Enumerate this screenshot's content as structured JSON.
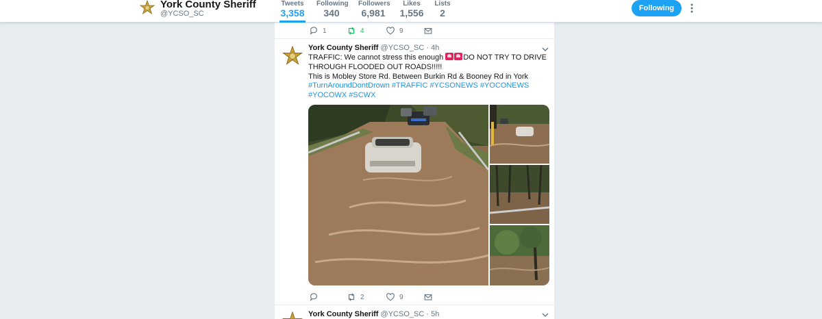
{
  "profile": {
    "name": "York County Sheriff",
    "handle": "@YCSO_SC"
  },
  "stats": [
    {
      "label": "Tweets",
      "value": "3,358",
      "active": true
    },
    {
      "label": "Following",
      "value": "340",
      "active": false
    },
    {
      "label": "Followers",
      "value": "6,981",
      "active": false
    },
    {
      "label": "Likes",
      "value": "1,556",
      "active": false
    },
    {
      "label": "Lists",
      "value": "2",
      "active": false
    }
  ],
  "follow_button": "Following",
  "prev_tweet_actions": {
    "reply": "1",
    "retweet": "4",
    "like": "9"
  },
  "tweet": {
    "name": "York County Sheriff",
    "handle": "@YCSO_SC",
    "time": "· 4h",
    "text_a": "TRAFFIC: We cannot stress this enough ",
    "text_b": "DO NOT TRY TO DRIVE THROUGH FLOODED OUT ROADS!!!!!",
    "text_c": "This is Mobley Store Rd. Between Burkin Rd & Booney Rd in York",
    "hashtags": "#TurnAroundDontDrown #TRAFFIC #YCSONEWS #YOCONEWS #YOCOWX #SCWX",
    "actions": {
      "reply": "",
      "retweet": "2",
      "like": "9"
    }
  },
  "next_tweet": {
    "name": "York County Sheriff",
    "handle": "@YCSO_SC",
    "time": "· 5h"
  },
  "colors": {
    "accent": "#1da1f2",
    "retweet_active": "#17bf63",
    "muted": "#657786",
    "background": "#e6ecf0"
  }
}
